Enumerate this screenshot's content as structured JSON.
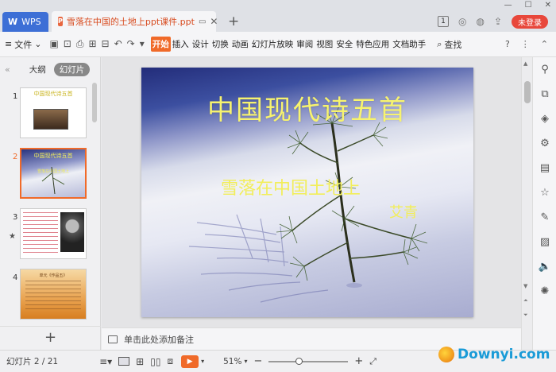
{
  "tabs": {
    "home": "WPS",
    "document": "雪落在中国的土地上ppt课件.ppt"
  },
  "titlebar": {
    "count": "1",
    "login": "未登录"
  },
  "toolbar": {
    "file": "文件",
    "ribbon": [
      "开始",
      "插入",
      "设计",
      "切换",
      "动画",
      "幻灯片放映",
      "审阅",
      "视图",
      "安全",
      "特色应用",
      "文档助手"
    ],
    "active_index": 0,
    "search": "查找"
  },
  "leftpanel": {
    "tab_outline": "大纲",
    "tab_slides": "幻灯片",
    "thumbs": [
      {
        "num": "1",
        "selected": false
      },
      {
        "num": "2",
        "selected": true
      },
      {
        "num": "3",
        "selected": false
      },
      {
        "num": "4",
        "selected": false
      }
    ],
    "thumb1_title": "中国现代诗五首",
    "thumb2_title": "中国现代诗五首",
    "thumb2_sub": "雪落在中国土地上",
    "thumb4_title": "单元《作品五》"
  },
  "slide": {
    "title": "中国现代诗五首",
    "subtitle": "雪落在中国土地上",
    "author": "艾青"
  },
  "notes": {
    "placeholder": "单击此处添加备注"
  },
  "status": {
    "slide_count": "幻灯片 2 / 21",
    "zoom": "51%",
    "zoom_value": 0.51
  },
  "watermark": {
    "site": "Downyi.com"
  },
  "colors": {
    "accent": "#f06a29",
    "wps_blue": "#3d6fd6",
    "login_red": "#e8473b",
    "slide_title": "#f7f36f"
  }
}
